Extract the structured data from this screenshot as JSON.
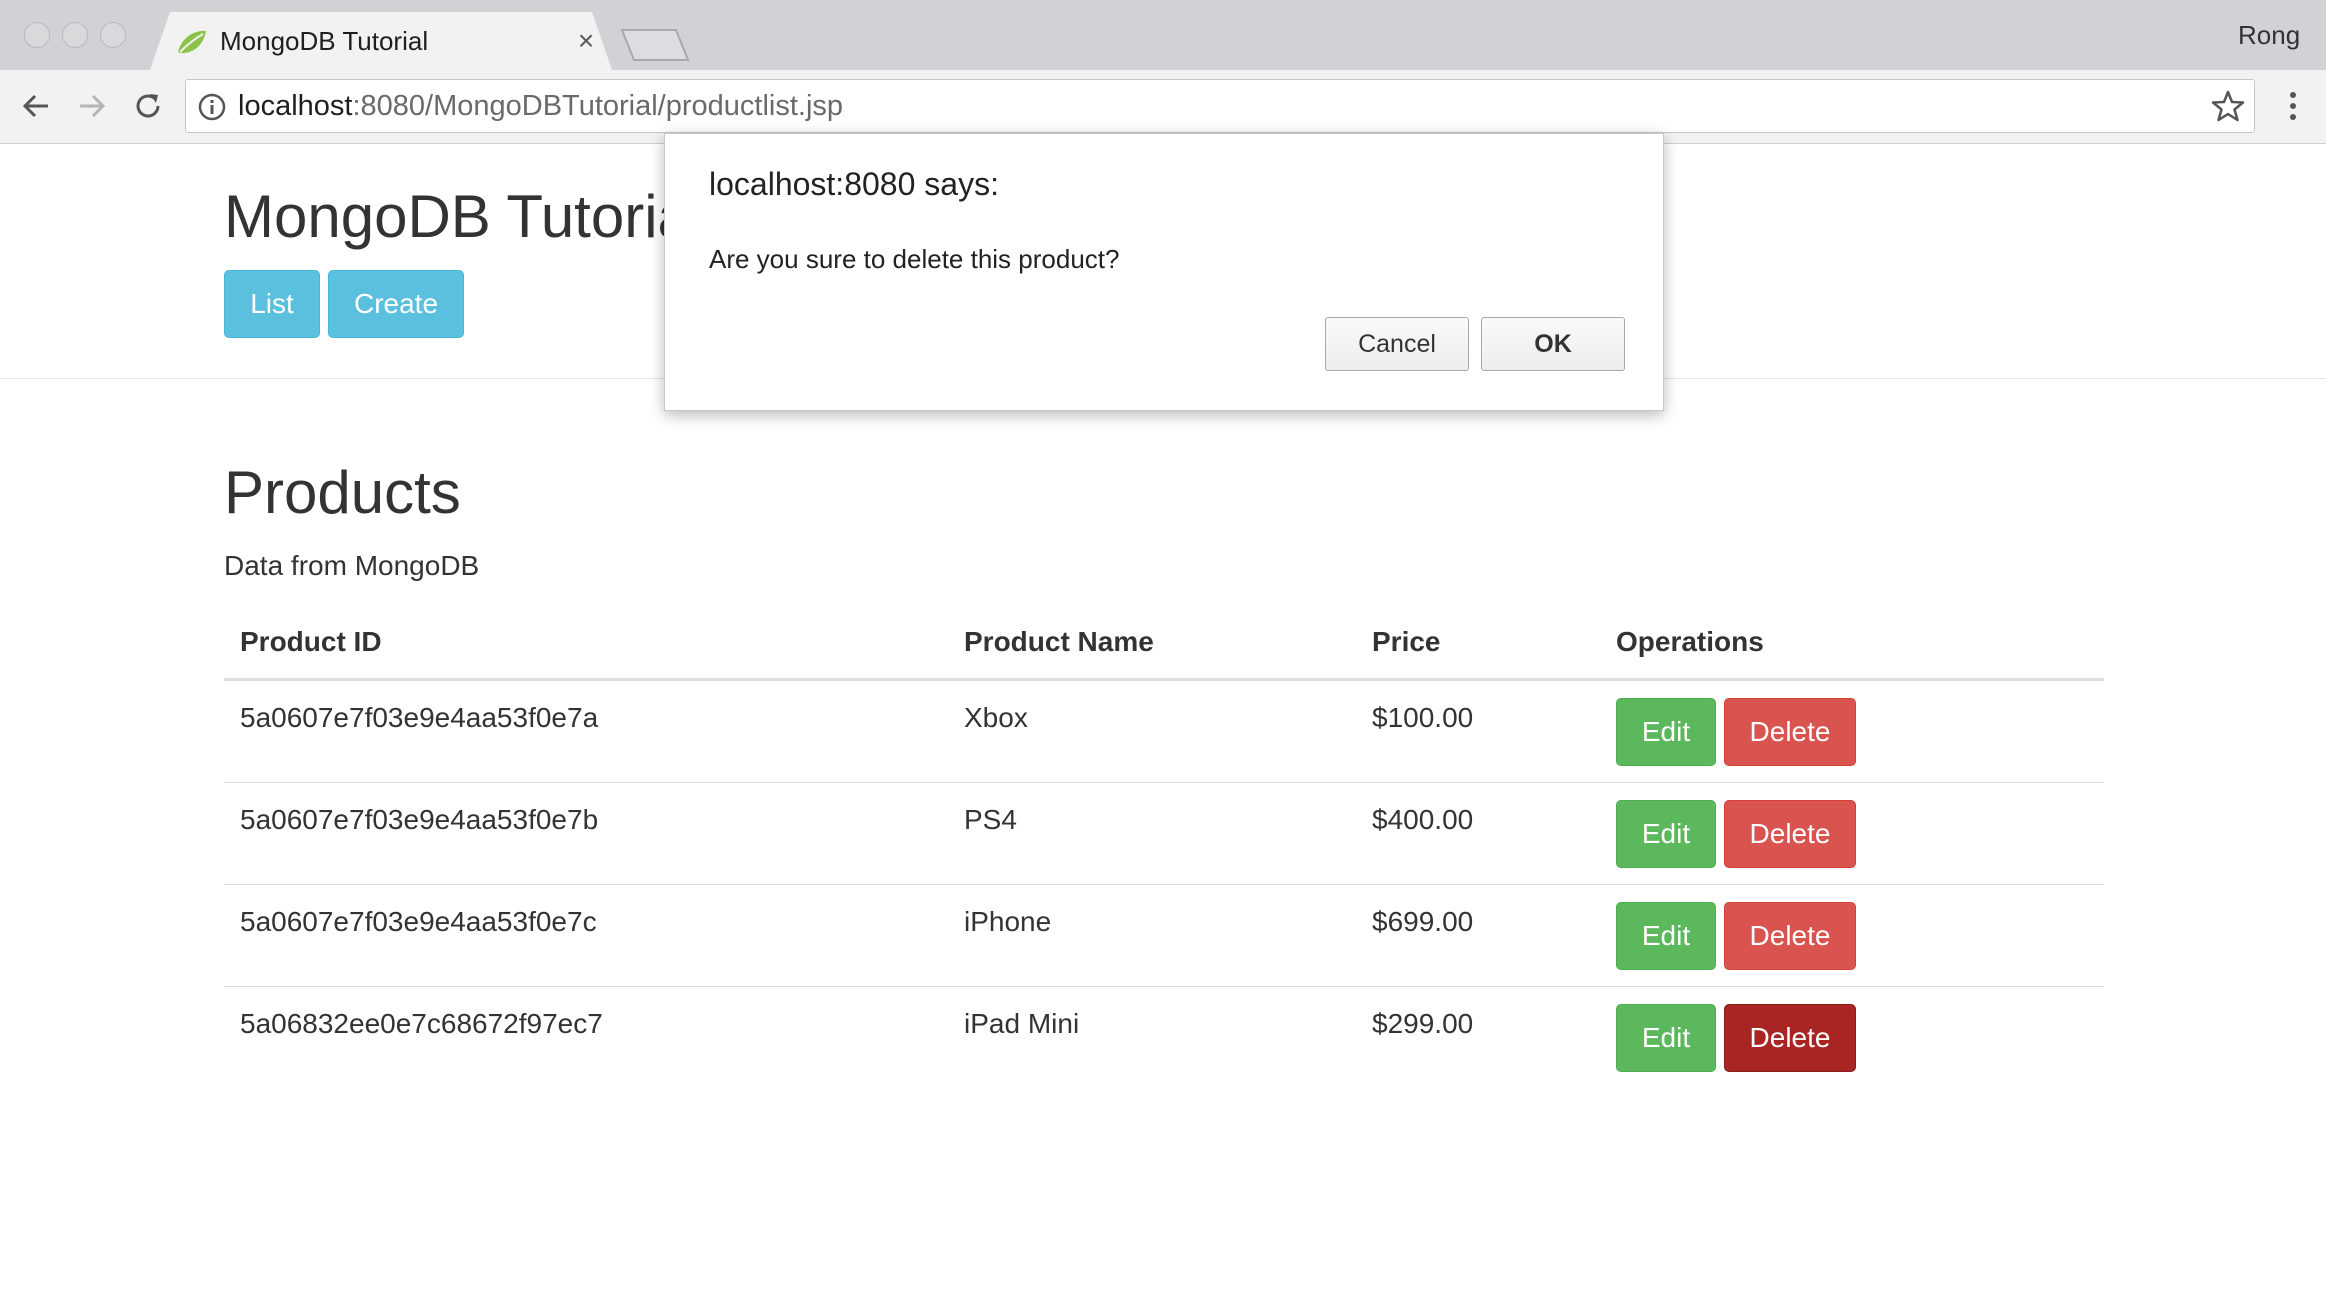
{
  "browser": {
    "tab_title": "MongoDB Tutorial",
    "tab_close": "×",
    "profile_name": "Rong",
    "url_host": "localhost",
    "url_rest": ":8080/MongoDBTutorial/productlist.jsp"
  },
  "header": {
    "title": "MongoDB Tutorial",
    "list_button": "List",
    "create_button": "Create"
  },
  "main": {
    "title": "Products",
    "subtitle": "Data from MongoDB"
  },
  "table": {
    "columns": [
      "Product ID",
      "Product Name",
      "Price",
      "Operations"
    ],
    "rows": [
      {
        "id": "5a0607e7f03e9e4aa53f0e7a",
        "name": "Xbox",
        "price": "$100.00",
        "edit": "Edit",
        "delete": "Delete"
      },
      {
        "id": "5a0607e7f03e9e4aa53f0e7b",
        "name": "PS4",
        "price": "$400.00",
        "edit": "Edit",
        "delete": "Delete"
      },
      {
        "id": "5a0607e7f03e9e4aa53f0e7c",
        "name": "iPhone",
        "price": "$699.00",
        "edit": "Edit",
        "delete": "Delete"
      },
      {
        "id": "5a06832ee0e7c68672f97ec7",
        "name": "iPad Mini",
        "price": "$299.00",
        "edit": "Edit",
        "delete": "Delete"
      }
    ]
  },
  "dialog": {
    "title": "localhost:8080 says:",
    "message": "Are you sure to delete this product?",
    "cancel": "Cancel",
    "ok": "OK"
  },
  "colors": {
    "info": "#5bc0de",
    "success": "#5cb85c",
    "danger": "#d9534f",
    "danger_active": "#a82524"
  }
}
